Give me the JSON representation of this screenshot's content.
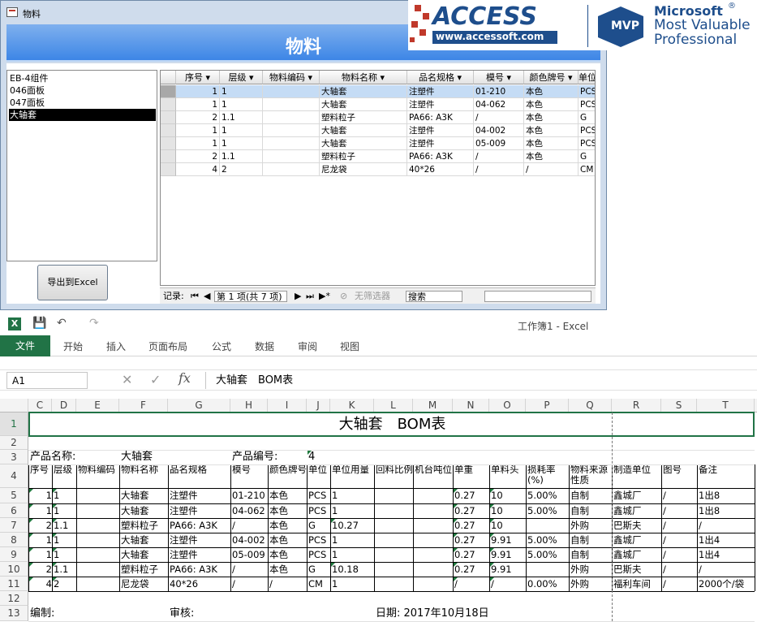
{
  "access": {
    "window_title": "物料",
    "form_title": "物料",
    "list_items": [
      "EB-4组件",
      "046面板",
      "047面板",
      "大轴套"
    ],
    "export_button": "导出到Excel",
    "grid_headers": [
      "序号",
      "层级",
      "物料编码",
      "物料名称",
      "品名规格",
      "模号",
      "颜色牌号",
      "单位"
    ],
    "grid_rows": [
      [
        "1",
        "1",
        "",
        "大轴套",
        "注塑件",
        "01-210",
        "本色",
        "PCS"
      ],
      [
        "1",
        "1",
        "",
        "大轴套",
        "注塑件",
        "04-062",
        "本色",
        "PCS"
      ],
      [
        "2",
        "1.1",
        "",
        "塑料粒子",
        "PA66: A3K",
        "/",
        "本色",
        "G"
      ],
      [
        "1",
        "1",
        "",
        "大轴套",
        "注塑件",
        "04-002",
        "本色",
        "PCS"
      ],
      [
        "1",
        "1",
        "",
        "大轴套",
        "注塑件",
        "05-009",
        "本色",
        "PCS"
      ],
      [
        "2",
        "1.1",
        "",
        "塑料粒子",
        "PA66: A3K",
        "/",
        "本色",
        "G"
      ],
      [
        "4",
        "2",
        "",
        "尼龙袋",
        "40*26",
        "/",
        "/",
        "CM"
      ]
    ],
    "nav": {
      "label": "记录:",
      "position": "第 1 项(共 7 项)",
      "filter": "无筛选器",
      "search": "搜索"
    }
  },
  "logo": {
    "access": "ACCESS",
    "url": "www.accessoft.com",
    "mvp": "MVP",
    "microsoft": "Microsoft",
    "line2": "Most Valuable",
    "line3": "Professional",
    "reg": "®"
  },
  "excel": {
    "title": "工作簿1 - Excel",
    "tabs": [
      "文件",
      "开始",
      "插入",
      "页面布局",
      "公式",
      "数据",
      "审阅",
      "视图"
    ],
    "namebox": "A1",
    "formula": "大轴套　BOM表",
    "fx": "fx",
    "columns": [
      "C",
      "D",
      "E",
      "F",
      "G",
      "H",
      "I",
      "J",
      "K",
      "L",
      "M",
      "N",
      "O",
      "P",
      "Q",
      "R",
      "S",
      "T"
    ],
    "rows": [
      "1",
      "2",
      "3",
      "4",
      "5",
      "6",
      "7",
      "8",
      "9",
      "10",
      "11",
      "12",
      "13"
    ],
    "sheet_title": "大轴套　BOM表",
    "product_name_label": "产品名称:",
    "product_name": "大轴套",
    "product_code_label": "产品编号:",
    "product_code": "4",
    "headers": [
      "序号",
      "层级",
      "物料编码",
      "物料名称",
      "品名规格",
      "模号",
      "颜色牌号",
      "单位",
      "单位用量",
      "回料比例",
      "机台吨位",
      "单重",
      "单料头",
      "损耗率(%)",
      "物料来源性质",
      "制造单位",
      "图号",
      "备注"
    ],
    "data": [
      [
        "1",
        "1",
        "",
        "大轴套",
        "注塑件",
        "01-210",
        "本色",
        "PCS",
        "1",
        "",
        "",
        "0.27",
        "10",
        "5.00%",
        "自制",
        "鑫城厂",
        "/",
        "1出8"
      ],
      [
        "1",
        "1",
        "",
        "大轴套",
        "注塑件",
        "04-062",
        "本色",
        "PCS",
        "1",
        "",
        "",
        "0.27",
        "10",
        "5.00%",
        "自制",
        "鑫城厂",
        "/",
        "1出8"
      ],
      [
        "2",
        "1.1",
        "",
        "塑料粒子",
        "PA66: A3K",
        "/",
        "本色",
        "G",
        "10.27",
        "",
        "",
        "0.27",
        "10",
        "",
        "外购",
        "巴斯夫",
        "/",
        "/"
      ],
      [
        "1",
        "1",
        "",
        "大轴套",
        "注塑件",
        "04-002",
        "本色",
        "PCS",
        "1",
        "",
        "",
        "0.27",
        "9.91",
        "5.00%",
        "自制",
        "鑫城厂",
        "/",
        "1出4"
      ],
      [
        "1",
        "1",
        "",
        "大轴套",
        "注塑件",
        "05-009",
        "本色",
        "PCS",
        "1",
        "",
        "",
        "0.27",
        "9.91",
        "5.00%",
        "自制",
        "鑫城厂",
        "/",
        "1出4"
      ],
      [
        "2",
        "1.1",
        "",
        "塑料粒子",
        "PA66: A3K",
        "/",
        "本色",
        "G",
        "10.18",
        "",
        "",
        "0.27",
        "9.91",
        "",
        "外购",
        "巴斯夫",
        "/",
        "/"
      ],
      [
        "4",
        "2",
        "",
        "尼龙袋",
        "40*26",
        "/",
        "/",
        "CM",
        "1",
        "",
        "",
        "/",
        "/",
        "0.00%",
        "外购",
        "福利车间",
        "/",
        "2000个/袋"
      ]
    ],
    "footer": {
      "editor": "编制:",
      "reviewer": "审核:",
      "date": "日期: 2017年10月18日"
    }
  },
  "colors": {
    "excel_green": "#217346",
    "access_header": "#3d86e6"
  }
}
